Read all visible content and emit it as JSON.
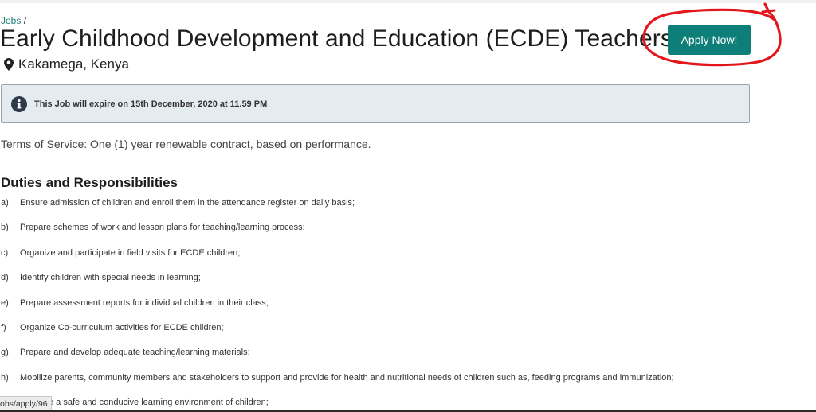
{
  "breadcrumb": {
    "link": "Jobs",
    "separator": "/"
  },
  "job": {
    "title": "Early Childhood Development and Education (ECDE) Teachers",
    "location": "Kakamega, Kenya",
    "apply_label": "Apply Now!"
  },
  "alert": {
    "icon": "info-icon",
    "text": "This Job will expire on 15th December, 2020 at 11.59 PM"
  },
  "terms": "Terms of Service: One (1) year renewable contract, based on performance.",
  "duties": {
    "heading": "Duties and Responsibilities",
    "items": [
      {
        "marker": "a)",
        "text": "Ensure admission of children and enroll them in the attendance register on daily basis;"
      },
      {
        "marker": "b)",
        "text": "Prepare schemes of work and lesson plans for teaching/learning process;"
      },
      {
        "marker": "c)",
        "text": "Organize and participate in field visits for ECDE children;"
      },
      {
        "marker": "d)",
        "text": "Identify children with special needs in learning;"
      },
      {
        "marker": "e)",
        "text": "Prepare assessment reports for individual children in their class;"
      },
      {
        "marker": "f)",
        "text": "Organize Co-curriculum activities for ECDE children;"
      },
      {
        "marker": "g)",
        "text": "Prepare and develop adequate teaching/learning materials;"
      },
      {
        "marker": "h)",
        "text": "Mobilize parents, community members and stakeholders to support and provide for health and nutritional needs of children such as, feeding programs and immunization;"
      },
      {
        "marker": "",
        "text": "e a safe and conducive learning environment of children;"
      }
    ]
  },
  "status_url": "obs/apply/96",
  "colors": {
    "accent": "#0d7e78",
    "annotation": "#e3161c",
    "alert_bg": "#e5ecef"
  }
}
